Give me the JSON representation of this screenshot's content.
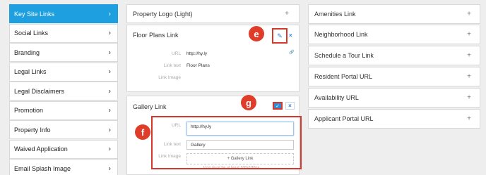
{
  "sidebar": {
    "items": [
      {
        "label": "Key Site Links",
        "active": true
      },
      {
        "label": "Social Links"
      },
      {
        "label": "Branding"
      },
      {
        "label": "Legal Links"
      },
      {
        "label": "Legal Disclaimers"
      },
      {
        "label": "Promotion"
      },
      {
        "label": "Property Info"
      },
      {
        "label": "Waived Application"
      },
      {
        "label": "Email Splash Image"
      }
    ],
    "chevron": "›"
  },
  "middle": {
    "property_logo": {
      "title": "Property Logo (Light)"
    },
    "floor_plans": {
      "title": "Floor Plans Link",
      "url_label": "URL",
      "url_value": "http://hy.ly",
      "link_text_label": "Link text",
      "link_text_value": "Floor Plans",
      "link_image_label": "Link Image",
      "callout": "e"
    },
    "gallery": {
      "title": "Gallery Link",
      "url_label": "URL",
      "url_value": "http://hy.ly",
      "link_text_label": "Link text",
      "link_text_value": "Gallery",
      "link_image_label": "Link Image",
      "add_button": "+ Gallery Link",
      "hint": "Icon must be at least 100x100px",
      "callout_g": "g",
      "callout_f": "f"
    }
  },
  "right": {
    "items": [
      "Amenities Link",
      "Neighborhood Link",
      "Schedule a Tour Link",
      "Resident Portal URL",
      "Availability URL",
      "Applicant Portal URL"
    ]
  },
  "glyphs": {
    "plus": "+",
    "close": "×",
    "pencil": "✎",
    "check": "✓",
    "link": "🔗"
  },
  "colors": {
    "accent": "#1ea0e0",
    "highlight": "#d9362b",
    "callout": "#e03c2a"
  }
}
